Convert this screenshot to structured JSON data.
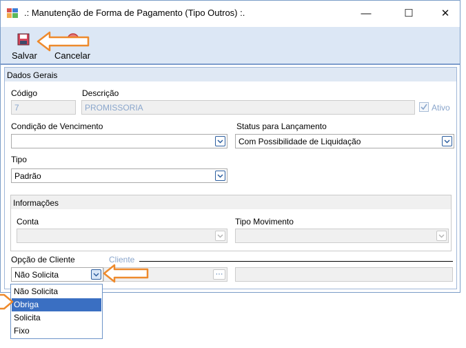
{
  "window": {
    "title": ".: Manutenção de Forma de Pagamento (Tipo Outros) :.",
    "minimize": "—",
    "maximize": "☐",
    "close": "✕"
  },
  "toolbar": {
    "save_label": "Salvar",
    "cancel_label": "Cancelar"
  },
  "dados_gerais": {
    "title": "Dados Gerais",
    "codigo": {
      "label": "Código",
      "value": "7"
    },
    "descricao": {
      "label": "Descrição",
      "value": "PROMISSORIA"
    },
    "ativo": {
      "label": "Ativo",
      "checked": true
    },
    "condicao_vencimento": {
      "label": "Condição de Vencimento",
      "value": ""
    },
    "status_lancamento": {
      "label": "Status para Lançamento",
      "value": "Com Possibilidade de Liquidação"
    },
    "tipo": {
      "label": "Tipo",
      "value": "Padrão"
    }
  },
  "informacoes": {
    "title": "Informações",
    "conta": {
      "label": "Conta",
      "value": ""
    },
    "tipo_movimento": {
      "label": "Tipo Movimento",
      "value": ""
    }
  },
  "opcao_cliente": {
    "label": "Opção de Cliente",
    "value": "Não Solicita",
    "options": [
      "Não Solicita",
      "Obriga",
      "Solicita",
      "Fixo"
    ],
    "selected_index": 1
  },
  "cliente": {
    "label": "Cliente",
    "lookup_label": "···"
  },
  "colors": {
    "arrow": "#ee8a2c",
    "selection": "#3a6fc2",
    "toolbar_bg": "#dce7f5",
    "accent_border": "#7d9ccc"
  }
}
